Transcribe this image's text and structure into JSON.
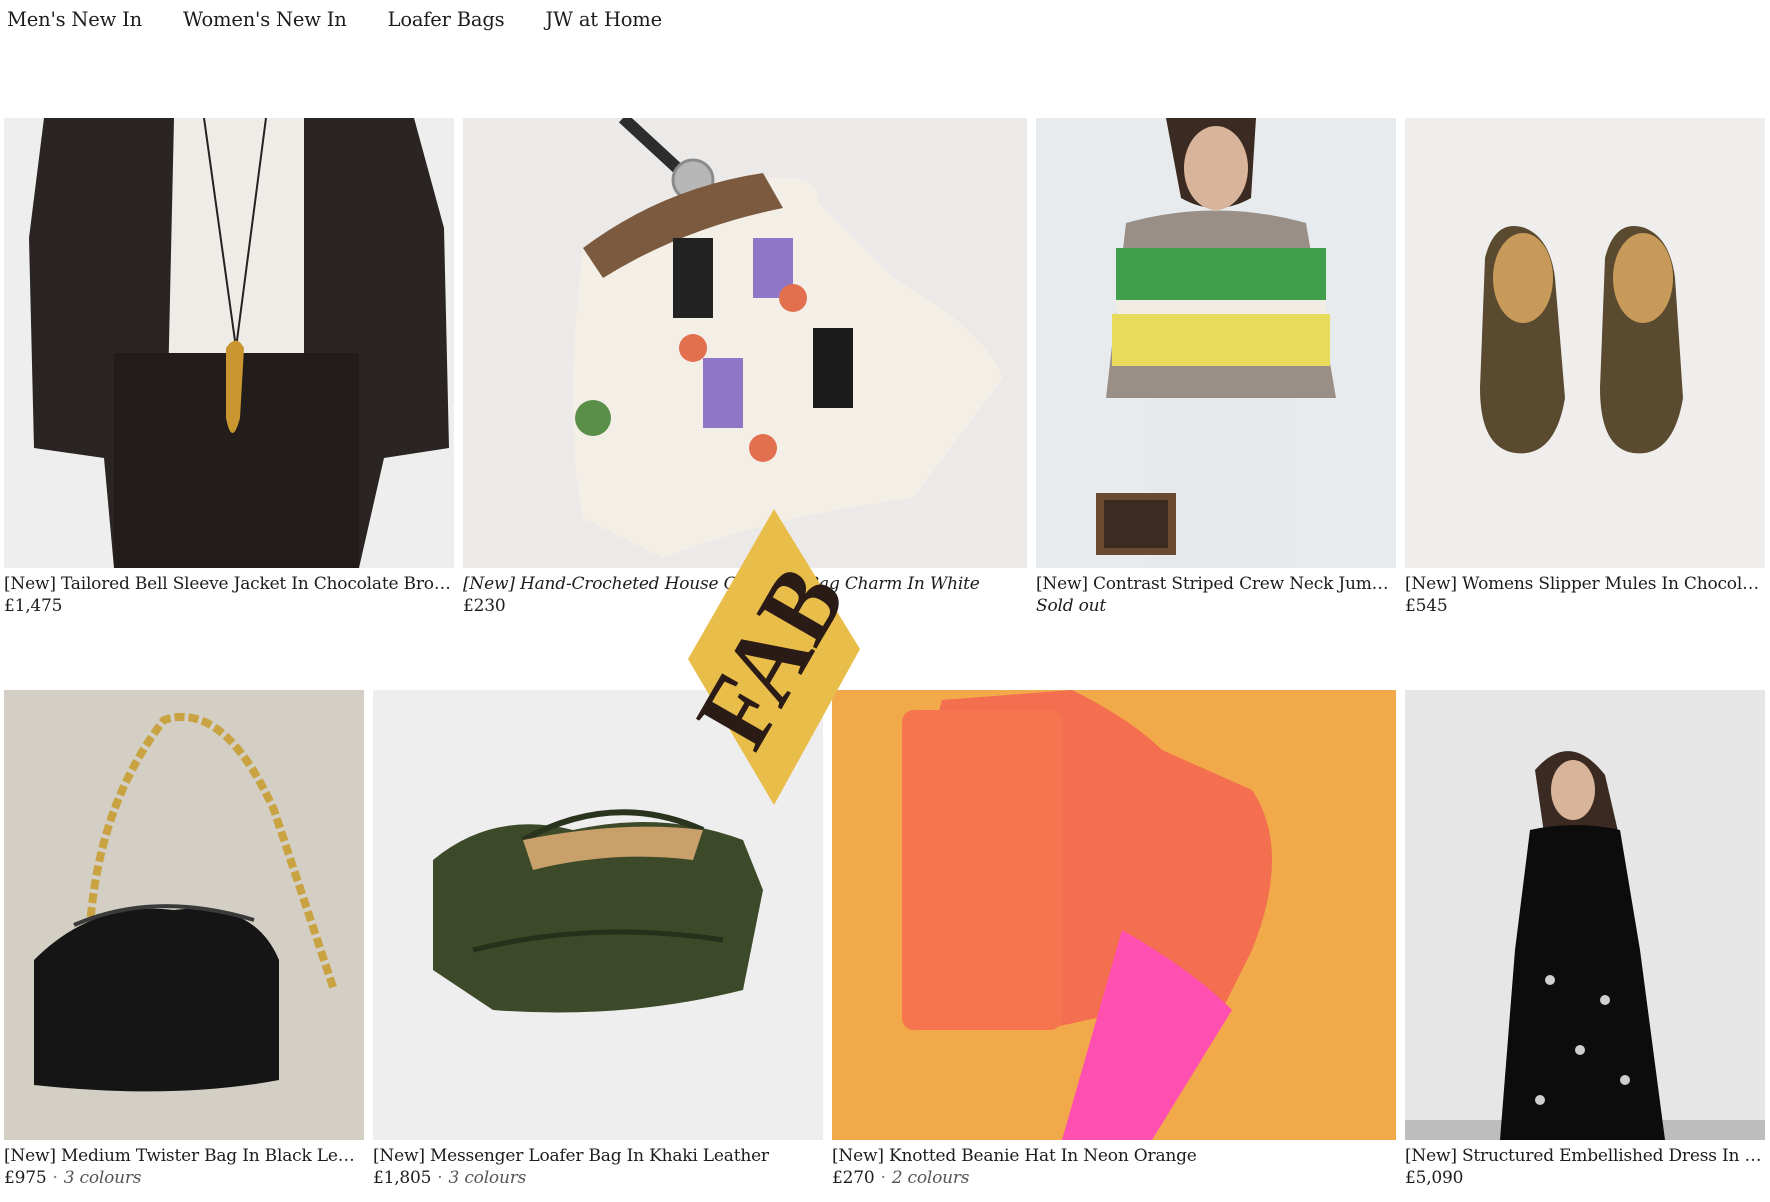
{
  "nav": {
    "items": [
      "Men's New In",
      "Women's New In",
      "Loafer Bags",
      "JW at Home"
    ]
  },
  "badge": {
    "text": "FAB",
    "color": "#e9bd4a"
  },
  "products": [
    {
      "title": "[New] Tailored Bell Sleeve Jacket In Chocolate Brown",
      "price": "£1,475",
      "colours": "",
      "status": ""
    },
    {
      "title": "[New] Hand-Crocheted House Cardigan Bag Charm In White",
      "price": "£230",
      "colours": "",
      "status": ""
    },
    {
      "title": "[New] Contrast Striped Crew Neck Jumper I...",
      "price": "",
      "colours": "",
      "status": "Sold out"
    },
    {
      "title": "[New] Womens Slipper Mules In Chocolate...",
      "price": "£545",
      "colours": "",
      "status": ""
    },
    {
      "title": "[New] Medium Twister Bag In Black Leather",
      "price": "£975",
      "colours": "3 colours",
      "status": ""
    },
    {
      "title": "[New] Messenger Loafer Bag In Khaki Leather",
      "price": "£1,805",
      "colours": "3 colours",
      "status": ""
    },
    {
      "title": "[New] Knotted Beanie Hat In Neon Orange",
      "price": "£270",
      "colours": "2 colours",
      "status": ""
    },
    {
      "title": "[New] Structured Embellished Dress In Black",
      "price": "£5,090",
      "colours": "",
      "status": ""
    }
  ],
  "separator": "·"
}
